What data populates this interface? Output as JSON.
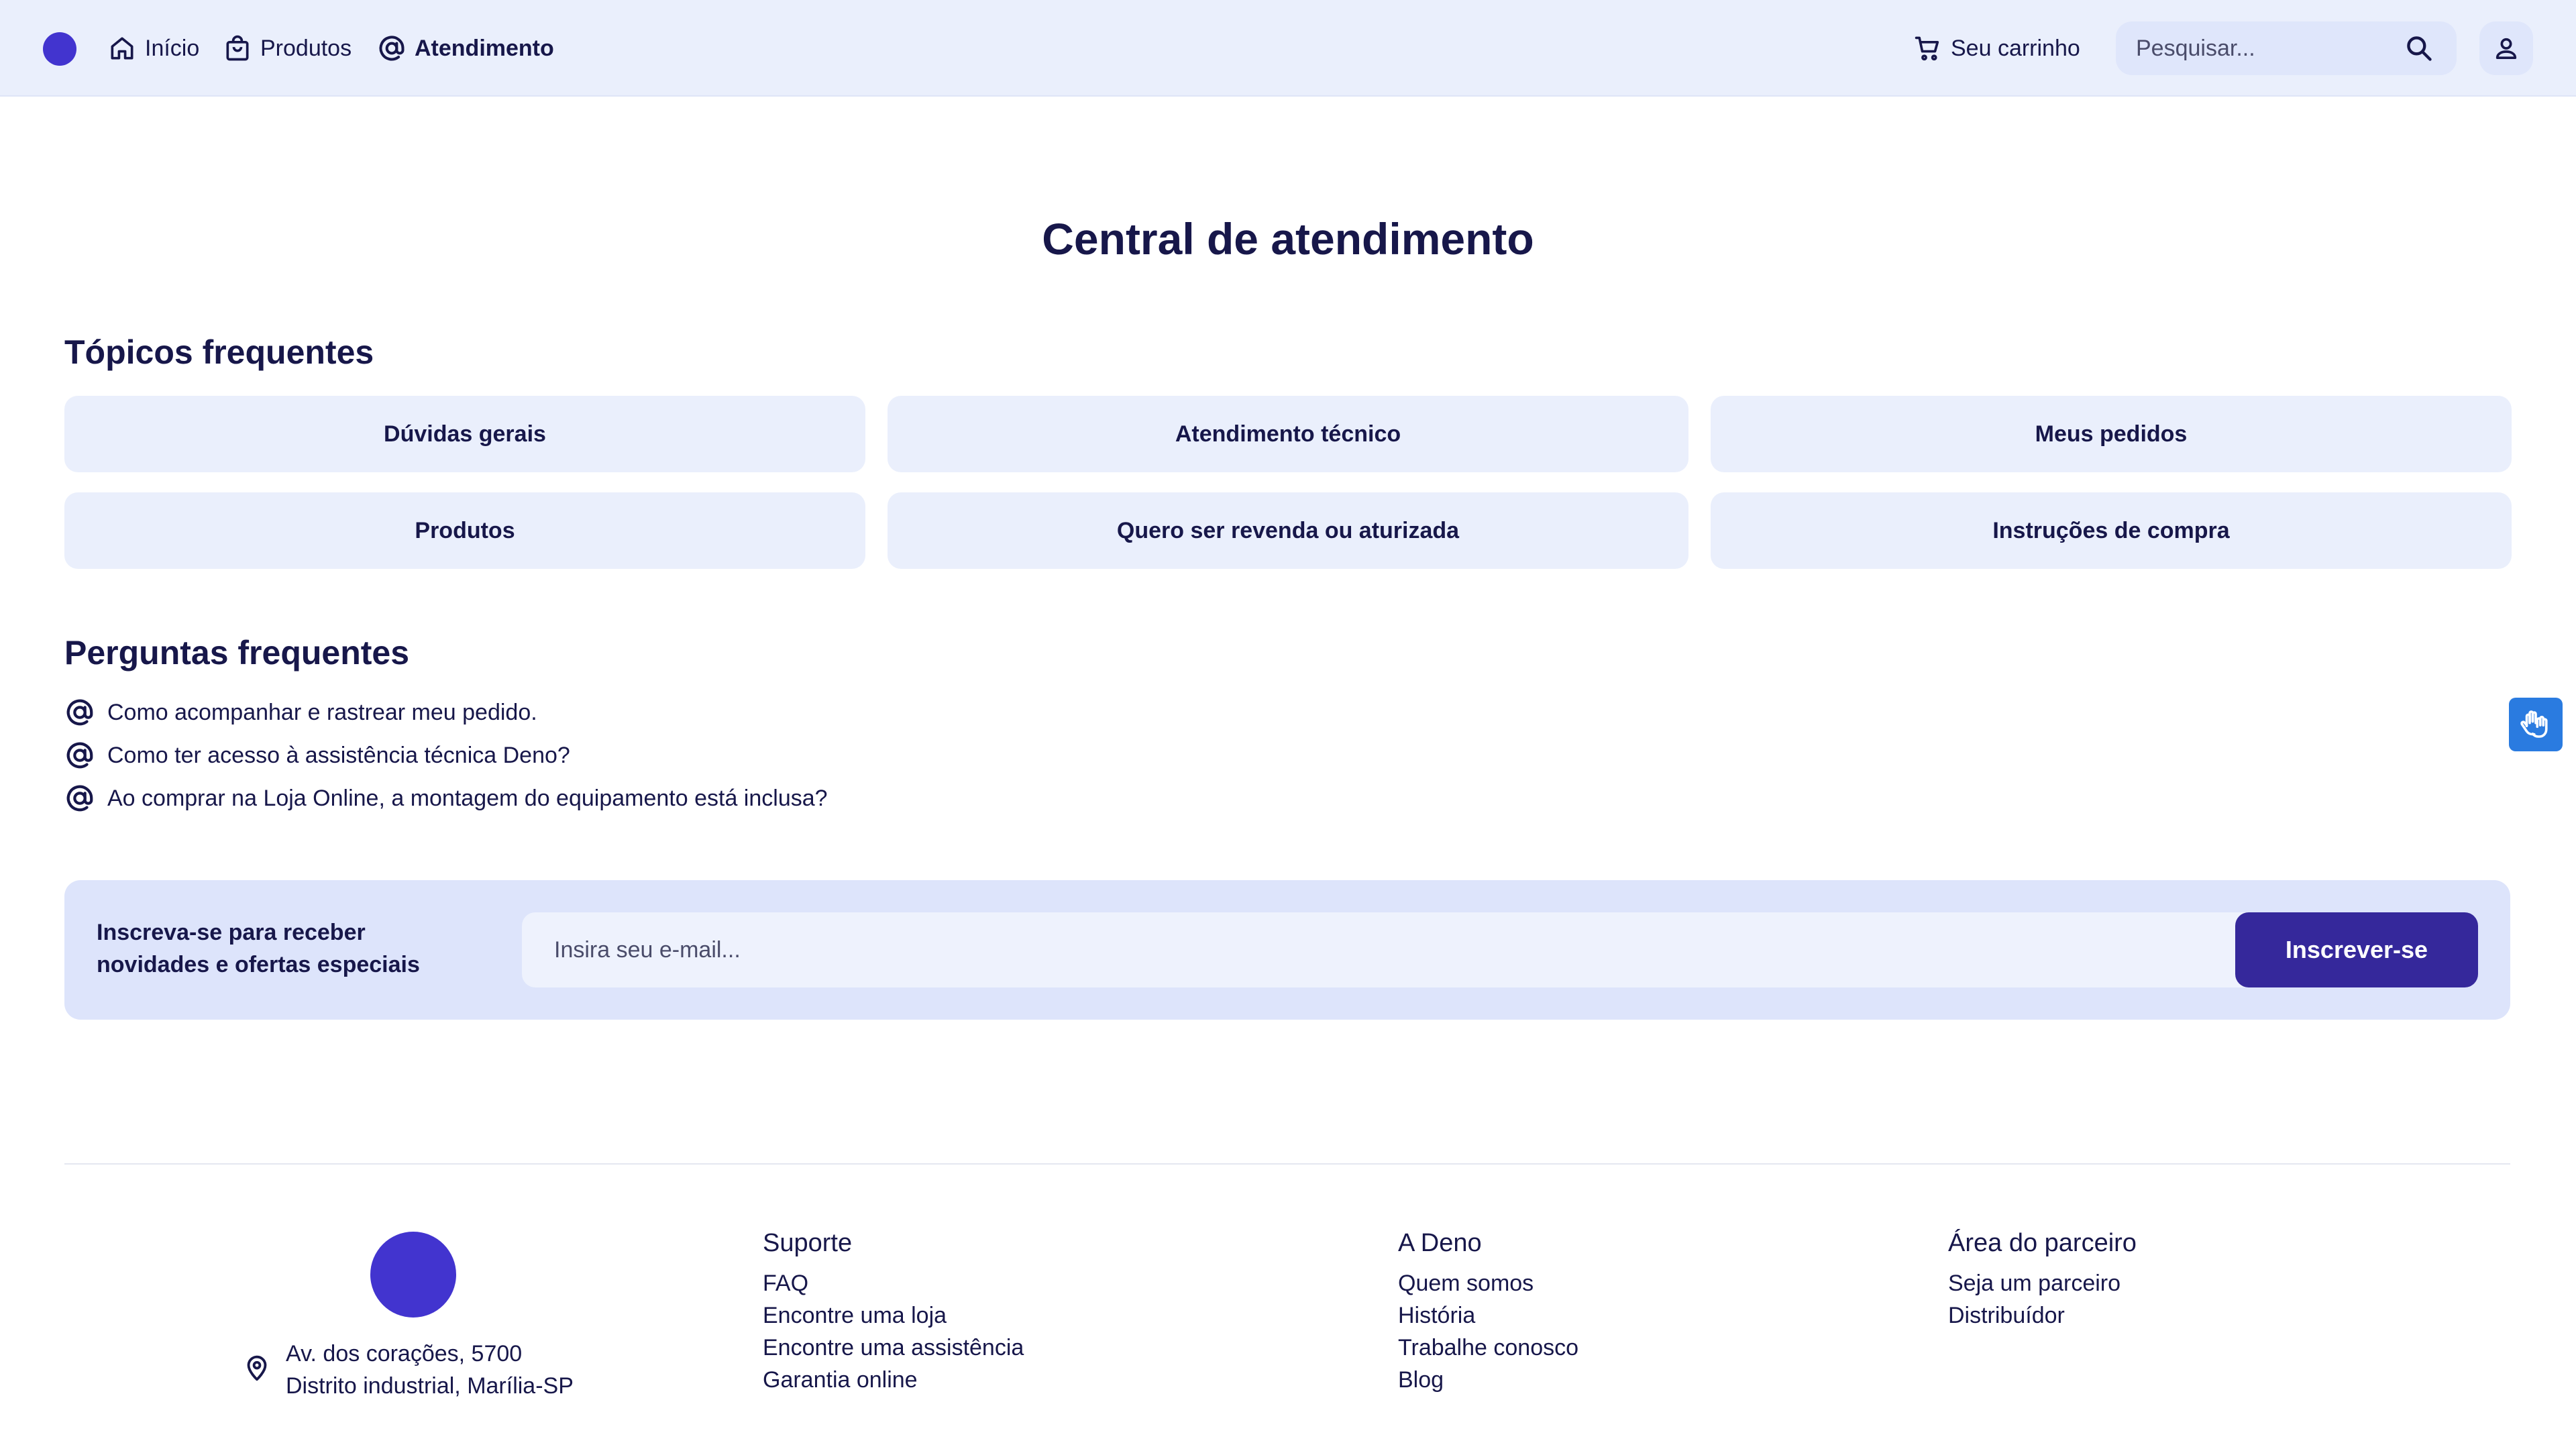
{
  "header": {
    "nav": [
      {
        "label": "Início",
        "icon": "home-icon"
      },
      {
        "label": "Produtos",
        "icon": "shopping-bag-icon"
      },
      {
        "label": "Atendimento",
        "icon": "at-icon",
        "active": true
      }
    ],
    "cart_label": "Seu carrinho",
    "search_placeholder": "Pesquisar...",
    "brand_color": "#4234cf"
  },
  "main": {
    "title": "Central de atendimento",
    "topics_title": "Tópicos frequentes",
    "topics": [
      "Dúvidas gerais",
      "Atendimento técnico",
      "Meus pedidos",
      "Produtos",
      "Quero ser revenda ou aturizada",
      "Instruções de compra"
    ],
    "faq_title": "Perguntas frequentes",
    "faq": [
      "Como acompanhar e rastrear meu pedido.",
      "Como ter acesso à assistência técnica Deno?",
      "Ao comprar na Loja Online, a montagem do equipamento está inclusa?"
    ]
  },
  "newsletter": {
    "text": "Inscreva-se para receber novidades e ofertas especiais",
    "placeholder": "Insira seu e-mail...",
    "button_label": "Inscrever-se",
    "button_color": "#35289b"
  },
  "footer": {
    "address_line1": "Av. dos corações, 5700",
    "address_line2": "Distrito industrial, Marília-SP",
    "columns": [
      {
        "title": "Suporte",
        "links": [
          "FAQ",
          "Encontre uma loja",
          "Encontre uma assistência",
          "Garantia online"
        ]
      },
      {
        "title": "A Deno",
        "links": [
          "Quem somos",
          "História",
          "Trabalhe conosco",
          "Blog"
        ]
      },
      {
        "title": "Área do parceiro",
        "links": [
          "Seja um parceiro",
          "Distribuídor"
        ]
      }
    ]
  },
  "accessibility": {
    "icon": "sign-language-hands-icon",
    "color": "#2a7be0"
  }
}
